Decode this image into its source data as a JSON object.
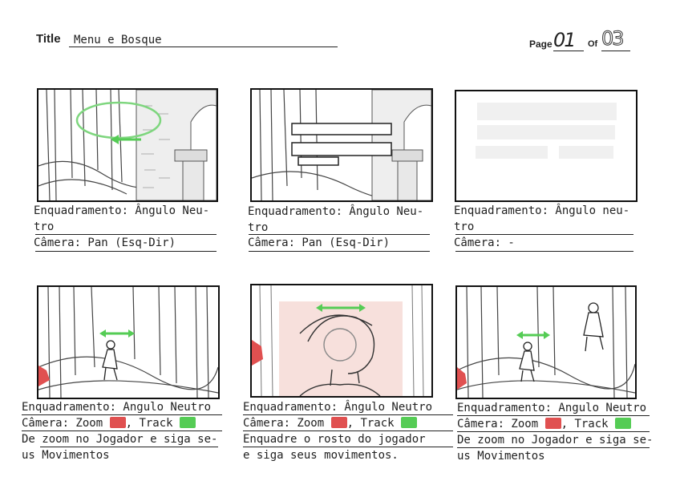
{
  "header": {
    "title_label": "Title",
    "title_value": "Menu e Bosque",
    "page_label": "Page",
    "page_number": "01",
    "of_label": "Of",
    "page_total": "03"
  },
  "panels": [
    {
      "framing": "Enquadramento: Ângulo Neu-",
      "framing_cont": "tro",
      "camera": "Câmera: Pan (Esq-Dir)"
    },
    {
      "framing": "Enquadramento: Ângulo Neu-",
      "framing_cont": "tro",
      "camera": "Câmera: Pan (Esq-Dir)"
    },
    {
      "framing": "Enquadramento: Ângulo neu-",
      "framing_cont": "tro",
      "camera": "Câmera: -"
    },
    {
      "framing": "Enquadramento: Angulo Neutro",
      "camera_prefix": "Câmera: Zoom",
      "camera_mid": ", Track",
      "note_line1": "De zoom no Jogador e siga se-",
      "note_line2": "us Movimentos"
    },
    {
      "framing": "Enquadramento: Ângulo Neutro",
      "camera_prefix": "Câmera: Zoom",
      "camera_mid": ", Track",
      "note_line1": "Enquadre o rosto do jogador",
      "note_line2": "e siga seus movimentos."
    },
    {
      "framing": "Enquadramento: Angulo Neutro",
      "camera_prefix": "Câmera: Zoom",
      "camera_mid": ", Track",
      "note_line1": "De zoom no Jogador e siga se-",
      "note_line2": "us Movimentos"
    }
  ],
  "colors": {
    "zoom_marker": "#e05050",
    "track_marker": "#55cc55",
    "focus_tint": "#f7e0dc"
  }
}
